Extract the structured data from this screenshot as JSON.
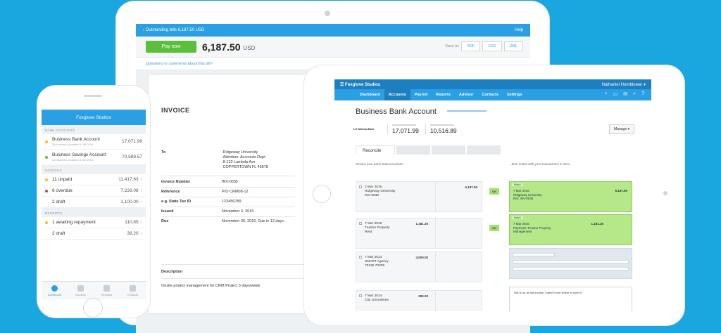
{
  "invoice_app": {
    "topbar_title": "Outstanding bills 6,187.50 USD",
    "topbar_help": "Help",
    "pay_label": "Pay now",
    "amount": "6,187.50",
    "currency": "USD",
    "save_to_label": "Save to:",
    "save_options": [
      "PDF",
      "CSV",
      "XML"
    ],
    "questions_link": "Questions or comments about this bill?",
    "invoice_title": "INVOICE",
    "to_label": "To",
    "to_lines": [
      "Ridgeway University",
      "Attention: Accounts Dept",
      "8-123 Lambda Ave",
      "COPPERTOWN FL 45678"
    ],
    "fields": [
      {
        "label": "Invoice Number",
        "value": "INV-0035"
      },
      {
        "label": "Reference",
        "value": "P/O CRM08-12"
      },
      {
        "label": "e.g. State Tax ID",
        "value": "123456789"
      },
      {
        "label": "Issued",
        "value": "November 4, 2016"
      },
      {
        "label": "Due",
        "value": "November 30, 2016, Due in 12 days"
      }
    ],
    "description_header": "Description",
    "description_text": "Onsite project management for CRM Project 3 days/week"
  },
  "phone_app": {
    "header": "Foxglove Studios",
    "section_bank": "BANK ACCOUNTS",
    "bank_accounts": [
      {
        "name": "Business Bank Account",
        "sub": "28 to match, updated 5 Oct 2016",
        "value": "17,071.99",
        "dot": "#f5c400"
      },
      {
        "name": "Business Savings Account",
        "sub": "All matched, updated 5 Oct 2016",
        "value": "70,589.57",
        "dot": "#5cbf3b"
      }
    ],
    "section_invoices": "INVOICES",
    "invoices": [
      {
        "name": "11 unpaid",
        "value": "11,417.63",
        "dot": "#f5c400"
      },
      {
        "name": "6 overdue",
        "value": "7,228.08",
        "dot": "#e03b3b"
      },
      {
        "name": "2 draft",
        "value": "1,100.00",
        "dot": ""
      }
    ],
    "section_receipts": "RECEIPTS",
    "receipts": [
      {
        "name": "1 awaiting repayment",
        "value": "110.85",
        "dot": "#f5c400"
      },
      {
        "name": "2 draft",
        "value": "39.20",
        "dot": ""
      }
    ],
    "tabs": [
      "Dashboard",
      "Invoices",
      "Receipts",
      "Contacts"
    ]
  },
  "reconcile_app": {
    "brand": "Foxglove Studios",
    "user": "Nathaniel Hornblower",
    "nav": [
      "Dashboard",
      "Accounts",
      "Payroll",
      "Reports",
      "Advisor",
      "Contacts",
      "Settings"
    ],
    "page_title": "Business Bank Account",
    "bank_logo": "C.H National Bank",
    "balance_statement": "17,071.99",
    "balance_xero": "10,516.89",
    "manage_label": "Manage ▾",
    "tab_reconcile": "Reconcile",
    "left_head": "Review your bank statement lines...",
    "right_head": "...then match with your transactions in Xero",
    "statement_lines": [
      {
        "date": "2 Mar 2016",
        "payee": "Ridgeway University",
        "ref": "INV-0035",
        "amount": "6,187.50"
      },
      {
        "date": "7 Mar 2016",
        "payee": "Truston Property",
        "ref": "Rent",
        "amount": "1,181.25"
      },
      {
        "date": "7 Mar 2014",
        "payee": "SMART Agency",
        "ref": "70135 70209",
        "amount": "4,000.00"
      },
      {
        "date": "7 Mar 2014",
        "payee": "City Limousines",
        "ref": "",
        "amount": "290.00"
      }
    ],
    "matches": [
      {
        "tag": "Match",
        "date": "7 Mar 2016",
        "payee": "Ridgeway University",
        "ref": "Ref: INV-0035",
        "amount": "6,187.50"
      },
      {
        "tag": "Match",
        "date": "7 Mar 2016",
        "payee": "Payment: Truston Property",
        "ref": "Management",
        "amount": "1,181.25"
      }
    ],
    "ok_label": "OK",
    "note_text": "This is for an old invoice, I wasn't sure where to code it"
  }
}
